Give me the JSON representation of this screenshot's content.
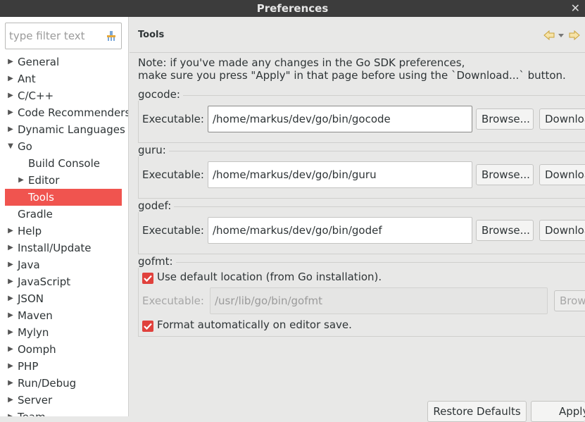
{
  "window": {
    "title": "Preferences",
    "close_icon": "close-icon"
  },
  "filter": {
    "placeholder": "type filter text",
    "icon": "clear-filter-icon"
  },
  "tree": [
    {
      "label": "General",
      "expandable": true,
      "expanded": false,
      "level": 0
    },
    {
      "label": "Ant",
      "expandable": true,
      "expanded": false,
      "level": 0
    },
    {
      "label": "C/C++",
      "expandable": true,
      "expanded": false,
      "level": 0
    },
    {
      "label": "Code Recommenders",
      "expandable": true,
      "expanded": false,
      "level": 0
    },
    {
      "label": "Dynamic Languages",
      "expandable": true,
      "expanded": false,
      "level": 0
    },
    {
      "label": "Go",
      "expandable": true,
      "expanded": true,
      "level": 0
    },
    {
      "label": "Build Console",
      "expandable": false,
      "expanded": false,
      "level": 1
    },
    {
      "label": "Editor",
      "expandable": true,
      "expanded": false,
      "level": 1
    },
    {
      "label": "Tools",
      "expandable": false,
      "expanded": false,
      "level": 1,
      "selected": true
    },
    {
      "label": "Gradle",
      "expandable": false,
      "expanded": false,
      "level": 0
    },
    {
      "label": "Help",
      "expandable": true,
      "expanded": false,
      "level": 0
    },
    {
      "label": "Install/Update",
      "expandable": true,
      "expanded": false,
      "level": 0
    },
    {
      "label": "Java",
      "expandable": true,
      "expanded": false,
      "level": 0
    },
    {
      "label": "JavaScript",
      "expandable": true,
      "expanded": false,
      "level": 0
    },
    {
      "label": "JSON",
      "expandable": true,
      "expanded": false,
      "level": 0
    },
    {
      "label": "Maven",
      "expandable": true,
      "expanded": false,
      "level": 0
    },
    {
      "label": "Mylyn",
      "expandable": true,
      "expanded": false,
      "level": 0
    },
    {
      "label": "Oomph",
      "expandable": true,
      "expanded": false,
      "level": 0
    },
    {
      "label": "PHP",
      "expandable": true,
      "expanded": false,
      "level": 0
    },
    {
      "label": "Run/Debug",
      "expandable": true,
      "expanded": false,
      "level": 0
    },
    {
      "label": "Server",
      "expandable": true,
      "expanded": false,
      "level": 0
    },
    {
      "label": "Team",
      "expandable": true,
      "expanded": false,
      "level": 0
    }
  ],
  "page": {
    "title": "Tools",
    "note_line1": "Note: if you've made any changes in the Go SDK preferences,",
    "note_line2": "make sure you press \"Apply\" in that page before using the `Download...` button.",
    "exec_label": "Executable:",
    "browse_label": "Browse...",
    "download_label": "Download...",
    "gocode": {
      "title": "gocode:",
      "path": "/home/markus/dev/go/bin/gocode"
    },
    "guru": {
      "title": "guru:",
      "path": "/home/markus/dev/go/bin/guru"
    },
    "godef": {
      "title": "godef:",
      "path": "/home/markus/dev/go/bin/godef"
    },
    "gofmt": {
      "title": "gofmt:",
      "use_default_label": "Use default location (from Go installation).",
      "use_default_checked": true,
      "path": "/usr/lib/go/bin/gofmt",
      "format_on_save_label": "Format automatically on editor save.",
      "format_on_save_checked": true
    },
    "restore_defaults_label": "Restore Defaults",
    "apply_label": "Apply"
  },
  "colors": {
    "selection": "#f0544f",
    "checkbox": "#e0413c",
    "titlebar": "#3c3c3c"
  }
}
